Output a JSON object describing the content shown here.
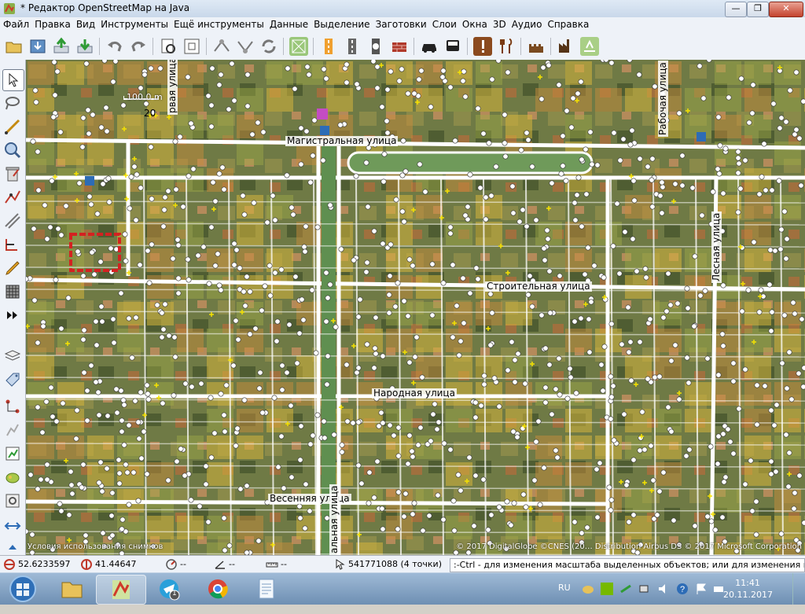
{
  "window": {
    "title": "* Редактор OpenStreetMap на Java",
    "minimize": "—",
    "maximize": "❐",
    "close": "✕"
  },
  "menu": [
    "Файл",
    "Правка",
    "Вид",
    "Инструменты",
    "Ещё инструменты",
    "Данные",
    "Выделение",
    "Заготовки",
    "Слои",
    "Окна",
    "3D",
    "Аудио",
    "Справка"
  ],
  "toolbar_icons": [
    "open-icon",
    "save-icon",
    "upload-icon",
    "download-icon",
    "undo-icon",
    "redo-icon",
    "preferences-icon",
    "zoom-data-icon",
    "split-way-icon",
    "combine-way-icon",
    "refresh-icon",
    "ortho-icon",
    "highway-primary-icon",
    "highway-secondary-icon",
    "highway-tertiary-icon",
    "brick-wall-icon",
    "car-icon",
    "bus-icon",
    "amenity-icon",
    "restaurant-icon",
    "castle-icon",
    "industrial-icon",
    "landuse-icon"
  ],
  "left_tools": [
    "select-icon",
    "lasso-icon",
    "draw-icon",
    "zoom-icon",
    "delete-icon",
    "improve-way-icon",
    "parallel-icon",
    "extrude-icon",
    "pencil-icon",
    "building-icon",
    "more-icon",
    "layers-icon",
    "tag-icon",
    "relation-icon",
    "properties-icon",
    "history-icon",
    "paint-icon",
    "validator-icon",
    "map-settings-icon",
    "expand-icon"
  ],
  "map": {
    "scale": "100.0 m",
    "zoom_label": "20",
    "streets": {
      "magistralnaya": "Магистральная улица",
      "stroitelnaya": "Строительная улица",
      "narodnaya": "Народная улица",
      "vesennyaya": "Весенняя улица",
      "rabochaya": "Рабочая улица",
      "lesnaya": "Лесная улица",
      "top_left_v": "рвая улица",
      "bottom_v": "альная улица"
    },
    "attribution_left": "Условия использования снимков",
    "attribution_right": "© 2017 DigitalGlobe ©CNES (20… Distribution Airbus DS © 2017 Microsoft Corporation"
  },
  "status": {
    "lat": "52.6233597",
    "lon": "41.44647",
    "heading": "--",
    "angle": "--",
    "length": "--",
    "selection": "541771088 (4 точки)",
    "message": ":-Ctrl - для изменения масштаба выделенных объектов; или для изменения выделения"
  },
  "taskbar": {
    "apps": [
      "explorer-icon",
      "josm-icon",
      "telegram-icon",
      "chrome-icon",
      "notepad-icon"
    ],
    "telegram_badge": "1",
    "language": "RU",
    "time": "11:41",
    "date": "20.11.2017"
  },
  "colors": {
    "accent": "#2d6cb6",
    "road": "#ffffff",
    "node": "#ffffff",
    "selection": "#d42121"
  }
}
